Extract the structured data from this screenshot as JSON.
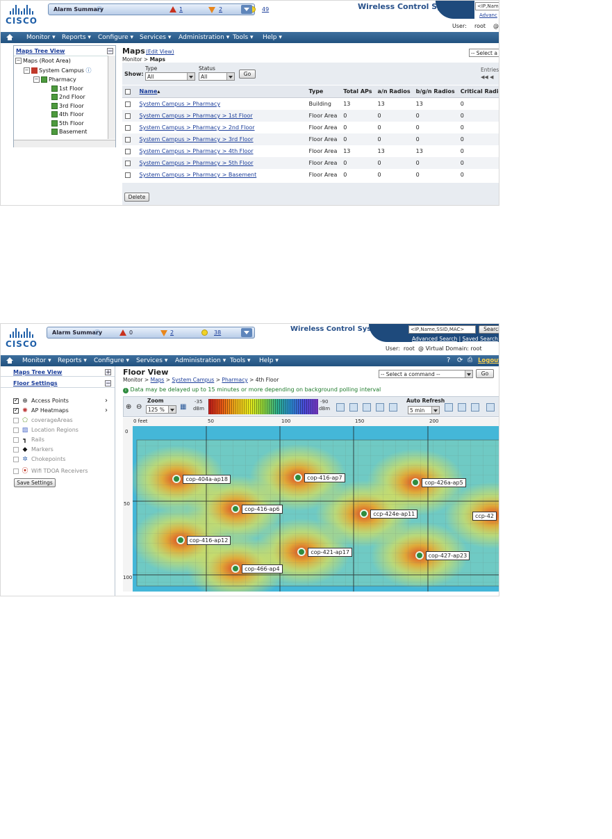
{
  "header": {
    "alarm_label": "Alarm Summary",
    "title": "Wireless Control System",
    "search_placeholder": "<IP,Name,SSID,MAC>",
    "search_button": "Search",
    "advanced_search": "Advanced Search",
    "saved_search": "Saved Search",
    "separator": "|",
    "user_label": "User:",
    "user_value": "root",
    "virtual_domain_label": "@ Virtual Domain:",
    "virtual_domain_value": "root",
    "logout": "Logout"
  },
  "nav": [
    "Monitor",
    "Reports",
    "Configure",
    "Services",
    "Administration",
    "Tools",
    "Help"
  ],
  "screen1": {
    "alarms": {
      "critical": "1",
      "major": "2",
      "minor": "49"
    },
    "search_text": "<IP,Name,",
    "adv_text": "Advanc",
    "user_label": "User:",
    "user_value": "root",
    "user_tail": "@",
    "tree_title": "Maps Tree View",
    "tree": {
      "root": "Maps (Root Area)",
      "campus": "System Campus",
      "building": "Pharmacy",
      "floors": [
        "1st Floor",
        "2nd Floor",
        "3rd Floor",
        "4th Floor",
        "5th Floor",
        "Basement"
      ]
    },
    "page_title": "Maps",
    "edit_view": "(Edit View)",
    "breadcrumb_monitor": "Monitor",
    "breadcrumb_sep": ">",
    "breadcrumb_current": "Maps",
    "command_select": "-- Select a",
    "filter": {
      "show_label": "Show:",
      "type_label": "Type",
      "type_value": "All",
      "status_label": "Status",
      "status_value": "All",
      "go": "Go",
      "entries_label": "Entries"
    },
    "table": {
      "columns": [
        "Name",
        "Type",
        "Total APs",
        "a/n Radios",
        "b/g/n Radios",
        "Critical Radio A"
      ],
      "rows": [
        [
          "System Campus > Pharmacy",
          "Building",
          "13",
          "13",
          "13",
          "0"
        ],
        [
          "System Campus > Pharmacy > 1st Floor",
          "Floor Area",
          "0",
          "0",
          "0",
          "0"
        ],
        [
          "System Campus > Pharmacy > 2nd Floor",
          "Floor Area",
          "0",
          "0",
          "0",
          "0"
        ],
        [
          "System Campus > Pharmacy > 3rd Floor",
          "Floor Area",
          "0",
          "0",
          "0",
          "0"
        ],
        [
          "System Campus > Pharmacy > 4th Floor",
          "Floor Area",
          "13",
          "13",
          "13",
          "0"
        ],
        [
          "System Campus > Pharmacy > 5th Floor",
          "Floor Area",
          "0",
          "0",
          "0",
          "0"
        ],
        [
          "System Campus > Pharmacy > Basement",
          "Floor Area",
          "0",
          "0",
          "0",
          "0"
        ]
      ]
    },
    "delete_button": "Delete"
  },
  "screen2": {
    "alarms": {
      "critical": "0",
      "major": "2",
      "minor": "38"
    },
    "tree_title": "Maps Tree View",
    "floor_settings_title": "Floor Settings",
    "settings": [
      {
        "label": "Access Points",
        "checked": true,
        "icon": "access-point-icon"
      },
      {
        "label": "AP Heatmaps",
        "checked": true,
        "icon": "heatmap-icon"
      },
      {
        "label": "coverageAreas",
        "checked": false,
        "icon": "coverage-icon"
      },
      {
        "label": "Location Regions",
        "checked": false,
        "icon": "region-icon"
      },
      {
        "label": "Rails",
        "checked": false,
        "icon": "rail-icon"
      },
      {
        "label": "Markers",
        "checked": false,
        "icon": "marker-icon"
      },
      {
        "label": "Chokepoints",
        "checked": false,
        "icon": "chokepoint-icon"
      },
      {
        "label": "Wifi TDOA Receivers",
        "checked": false,
        "icon": "tdoa-icon"
      }
    ],
    "save_settings": "Save Settings",
    "page_title": "Floor View",
    "breadcrumb": [
      "Monitor",
      "Maps",
      "System Campus",
      "Pharmacy",
      "4th Floor"
    ],
    "breadcrumb_sep": ">",
    "command_select": "-- Select a command --",
    "go": "Go",
    "notice": "Data may be delayed up to 15 minutes or more depending on background polling interval",
    "zoom_label": "Zoom",
    "zoom_value": "125 %",
    "dbm_high": "-35",
    "dbm_low": "-90",
    "dbm_unit": "dBm",
    "auto_refresh_label": "Auto Refresh",
    "auto_refresh_value": "5 min",
    "ruler_top": [
      "0 feet",
      "50",
      "100",
      "150",
      "200"
    ],
    "ruler_left": [
      "0",
      "50",
      "100"
    ],
    "aps": [
      {
        "name": "cop-404a-ap18",
        "fx": 0.12,
        "fy": 0.32
      },
      {
        "name": "cop-416-ap7",
        "fx": 0.45,
        "fy": 0.31
      },
      {
        "name": "cop-426a-ap5",
        "fx": 0.77,
        "fy": 0.34
      },
      {
        "name": "cop-416-ap6",
        "fx": 0.28,
        "fy": 0.5
      },
      {
        "name": "ccp-424e-ap11",
        "fx": 0.63,
        "fy": 0.53
      },
      {
        "name": "ccp-42",
        "fx": 0.98,
        "fy": 0.54
      },
      {
        "name": "cop-416-ap12",
        "fx": 0.13,
        "fy": 0.69
      },
      {
        "name": "cop-421-ap17",
        "fx": 0.46,
        "fy": 0.76
      },
      {
        "name": "cop-427-ap23",
        "fx": 0.78,
        "fy": 0.78
      },
      {
        "name": "cop-466-ap4",
        "fx": 0.28,
        "fy": 0.86
      }
    ]
  }
}
